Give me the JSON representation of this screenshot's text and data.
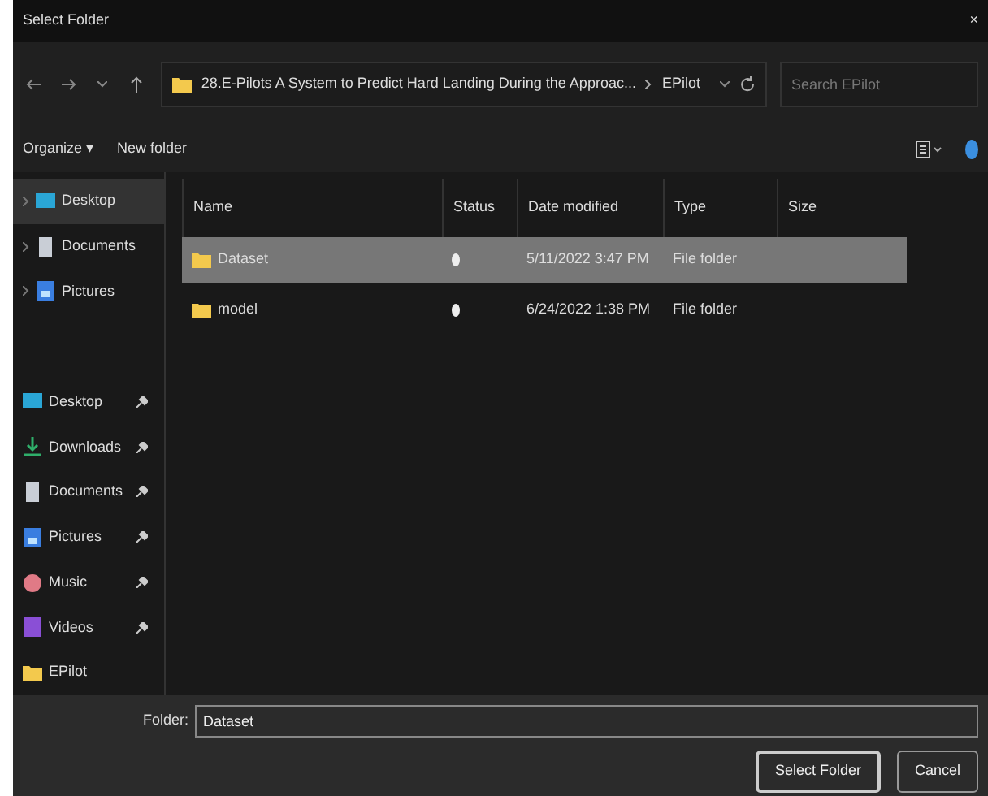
{
  "window": {
    "title": "Select Folder",
    "close": "×"
  },
  "address": {
    "path": "28.E-Pilots A System to Predict Hard Landing During the Approac...",
    "current": "EPilot",
    "search_placeholder": "Search EPilot"
  },
  "toolbar": {
    "organize": "Organize ▾",
    "new_folder": "New folder"
  },
  "nav_top": [
    {
      "label": "Desktop",
      "kind": "desktop",
      "selected": true
    },
    {
      "label": "Documents",
      "kind": "documents",
      "selected": false
    },
    {
      "label": "Pictures",
      "kind": "pictures",
      "selected": false
    }
  ],
  "quick_access": [
    {
      "label": "Desktop",
      "kind": "desktop",
      "pinned": true
    },
    {
      "label": "Downloads",
      "kind": "downloads",
      "pinned": true
    },
    {
      "label": "Documents",
      "kind": "documents",
      "pinned": true
    },
    {
      "label": "Pictures",
      "kind": "pictures",
      "pinned": true
    },
    {
      "label": "Music",
      "kind": "music",
      "pinned": true
    },
    {
      "label": "Videos",
      "kind": "videos",
      "pinned": true
    },
    {
      "label": "EPilot",
      "kind": "folder",
      "pinned": false
    }
  ],
  "table": {
    "columns": [
      "Name",
      "Status",
      "Date modified",
      "Type",
      "Size"
    ],
    "rows": [
      {
        "name": "Dataset",
        "date": "5/11/2022 3:47 PM",
        "type": "File folder",
        "selected": true
      },
      {
        "name": "model",
        "date": "6/24/2022 1:38 PM",
        "type": "File folder",
        "selected": false
      }
    ]
  },
  "footer": {
    "label": "Folder:",
    "value": "Dataset",
    "buttons": [
      "Select Folder",
      "Cancel"
    ]
  }
}
